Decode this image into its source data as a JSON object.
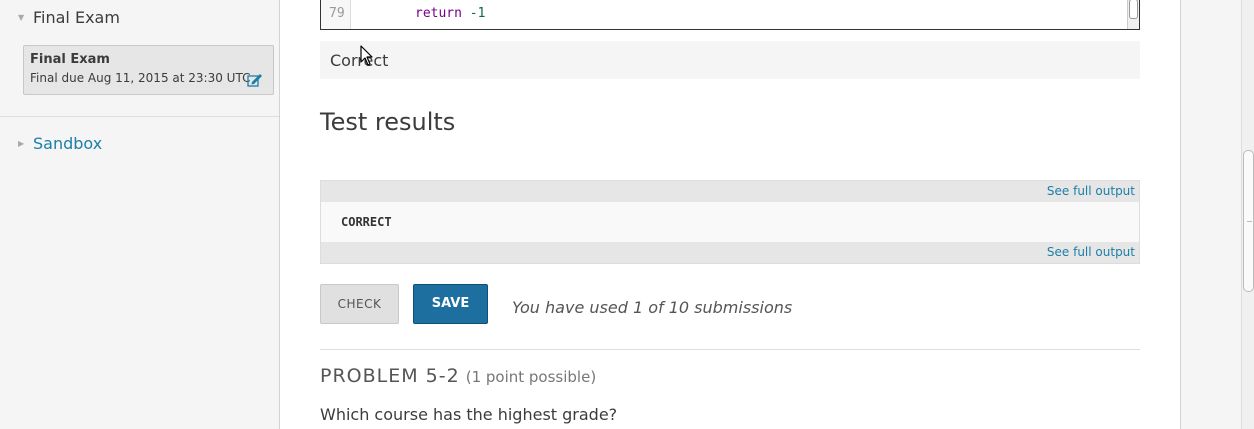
{
  "sidebar": {
    "chapter": {
      "title": "Final Exam"
    },
    "section": {
      "title": "Final Exam",
      "due": "Final due Aug 11, 2015 at 23:30 UTC"
    },
    "items": [
      {
        "label": "Sandbox"
      }
    ]
  },
  "code": {
    "line_number": "79",
    "keyword": "return",
    "value": "-1"
  },
  "status": {
    "text": "Correct"
  },
  "test_results": {
    "heading": "Test results",
    "see_full_output_top": "See full output",
    "output": "CORRECT",
    "see_full_output_bottom": "See full output"
  },
  "actions": {
    "check_label": "CHECK",
    "save_label": "SAVE",
    "submissions_text": "You have used 1 of 10 submissions"
  },
  "next_problem": {
    "title": "PROBLEM 5-2",
    "points": "(1 point possible)",
    "question": "Which course has the highest grade?"
  },
  "colors": {
    "link": "#1d7ea8",
    "save_button": "#1d6fa0",
    "sidebar_bg": "#f5f5f5"
  },
  "icons": [
    "chevron-down-icon",
    "edit-icon",
    "chevron-right-icon",
    "cursor-icon"
  ]
}
